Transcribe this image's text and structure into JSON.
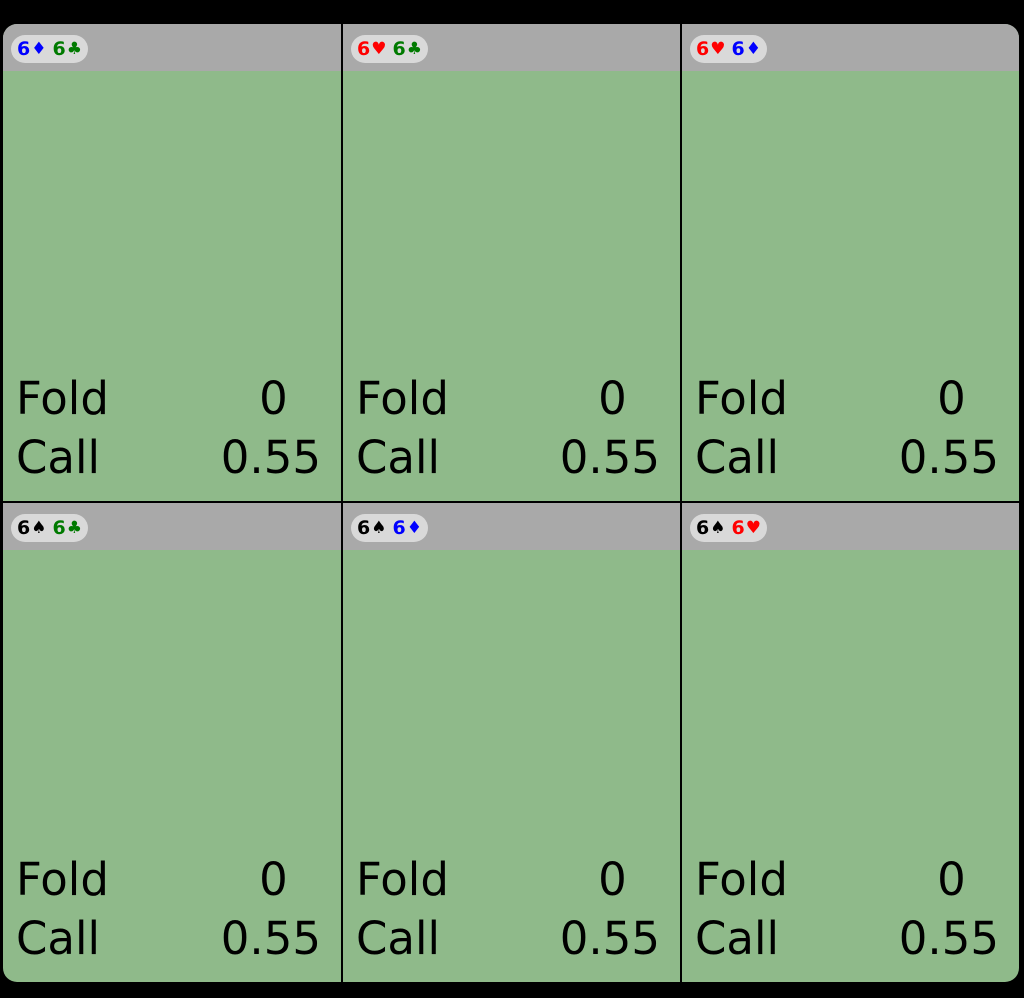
{
  "suit_colors": {
    "diamond": "#0000ff",
    "club": "#007a00",
    "heart": "#ff0000",
    "spade": "#000000"
  },
  "colors": {
    "cell_background": "#8fba8a",
    "header_background": "#a9a9a9",
    "pill_background": "#d9d9d9",
    "frame_background": "#000000"
  },
  "combos": [
    {
      "cards": [
        {
          "rank": "6",
          "suit": "♦",
          "suit_name": "diamond",
          "color": "#0000ff"
        },
        {
          "rank": "6",
          "suit": "♣",
          "suit_name": "club",
          "color": "#007a00"
        }
      ],
      "actions": [
        {
          "label": "Fold",
          "value": "0"
        },
        {
          "label": "Call",
          "value": "0.55"
        }
      ]
    },
    {
      "cards": [
        {
          "rank": "6",
          "suit": "♥",
          "suit_name": "heart",
          "color": "#ff0000"
        },
        {
          "rank": "6",
          "suit": "♣",
          "suit_name": "club",
          "color": "#007a00"
        }
      ],
      "actions": [
        {
          "label": "Fold",
          "value": "0"
        },
        {
          "label": "Call",
          "value": "0.55"
        }
      ]
    },
    {
      "cards": [
        {
          "rank": "6",
          "suit": "♥",
          "suit_name": "heart",
          "color": "#ff0000"
        },
        {
          "rank": "6",
          "suit": "♦",
          "suit_name": "diamond",
          "color": "#0000ff"
        }
      ],
      "actions": [
        {
          "label": "Fold",
          "value": "0"
        },
        {
          "label": "Call",
          "value": "0.55"
        }
      ]
    },
    {
      "cards": [
        {
          "rank": "6",
          "suit": "♠",
          "suit_name": "spade",
          "color": "#000000"
        },
        {
          "rank": "6",
          "suit": "♣",
          "suit_name": "club",
          "color": "#007a00"
        }
      ],
      "actions": [
        {
          "label": "Fold",
          "value": "0"
        },
        {
          "label": "Call",
          "value": "0.55"
        }
      ]
    },
    {
      "cards": [
        {
          "rank": "6",
          "suit": "♠",
          "suit_name": "spade",
          "color": "#000000"
        },
        {
          "rank": "6",
          "suit": "♦",
          "suit_name": "diamond",
          "color": "#0000ff"
        }
      ],
      "actions": [
        {
          "label": "Fold",
          "value": "0"
        },
        {
          "label": "Call",
          "value": "0.55"
        }
      ]
    },
    {
      "cards": [
        {
          "rank": "6",
          "suit": "♠",
          "suit_name": "spade",
          "color": "#000000"
        },
        {
          "rank": "6",
          "suit": "♥",
          "suit_name": "heart",
          "color": "#ff0000"
        }
      ],
      "actions": [
        {
          "label": "Fold",
          "value": "0"
        },
        {
          "label": "Call",
          "value": "0.55"
        }
      ]
    }
  ]
}
